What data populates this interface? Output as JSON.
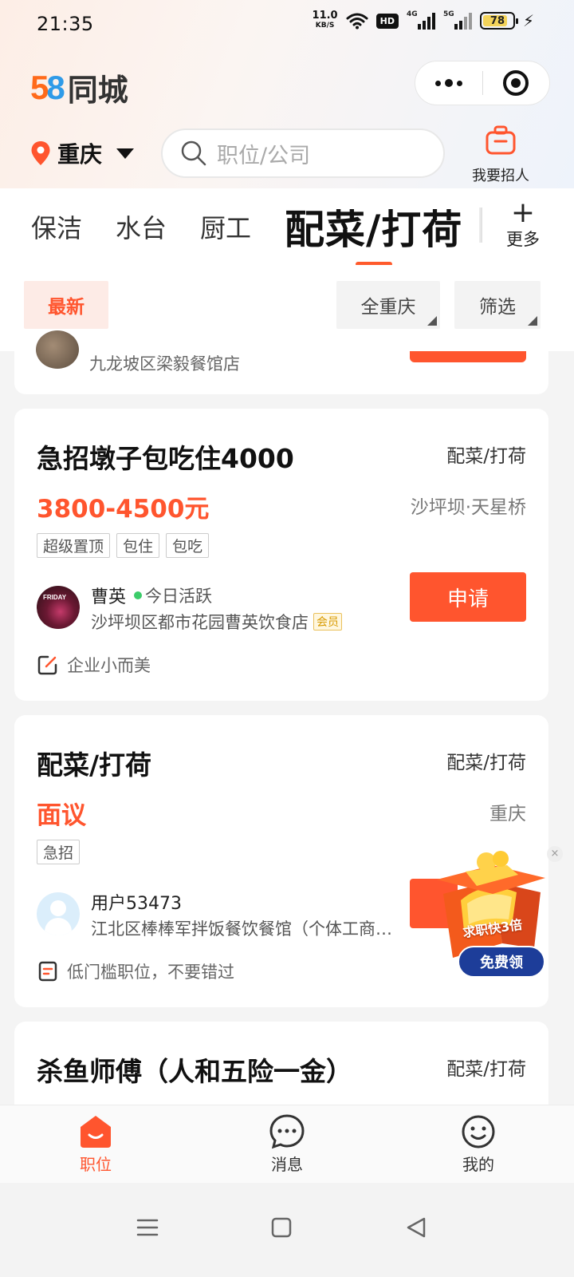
{
  "status_bar": {
    "time": "21:35",
    "net_speed": "11.0",
    "net_unit": "KB/S",
    "hd": "HD",
    "sim1": "4G",
    "sim2": "5G",
    "battery": "78"
  },
  "header": {
    "logo_num_5": "5",
    "logo_num_8": "8",
    "logo_text": "同城",
    "city": "重庆",
    "search_placeholder": "职位/公司",
    "recruit_label": "我要招人"
  },
  "categories": {
    "tabs": [
      "保洁",
      "水台",
      "厨工",
      "配菜/打荷"
    ],
    "active_index": 3,
    "more_label": "更多"
  },
  "filters": {
    "newest": "最新",
    "area": "全重庆",
    "filter": "筛选"
  },
  "colors": {
    "accent": "#ff552e",
    "active_green": "#3ccc6a"
  },
  "jobs": [
    {
      "company": "九龙坡区梁毅餐馆店"
    },
    {
      "title": "急招墩子包吃住4000",
      "category": "配菜/打荷",
      "salary": "3800-4500元",
      "location": "沙坪坝·天星桥",
      "tags": [
        "超级置顶",
        "包住",
        "包吃"
      ],
      "contact_name": "曹英",
      "active_status": "今日活跃",
      "company": "沙坪坝区都市花园曹英饮食店",
      "member_badge": "会员",
      "apply_label": "申请",
      "note": "企业小而美",
      "avatar_text": "FRIDAY"
    },
    {
      "title": "配菜/打荷",
      "category": "配菜/打荷",
      "salary": "面议",
      "location": "重庆",
      "tags": [
        "急招"
      ],
      "contact_name": "用户53473",
      "company": "江北区棒棒军拌饭餐饮餐馆（个体工商户）",
      "note": "低门槛职位，不要错过"
    },
    {
      "title": "杀鱼师傅（人和五险一金）",
      "category": "配菜/打荷"
    }
  ],
  "promo": {
    "slogan": "求职快3倍",
    "button": "免费领",
    "close": "×"
  },
  "bottom_nav": {
    "items": [
      {
        "label": "职位",
        "icon": "home-icon"
      },
      {
        "label": "消息",
        "icon": "message-icon"
      },
      {
        "label": "我的",
        "icon": "profile-icon"
      }
    ]
  }
}
